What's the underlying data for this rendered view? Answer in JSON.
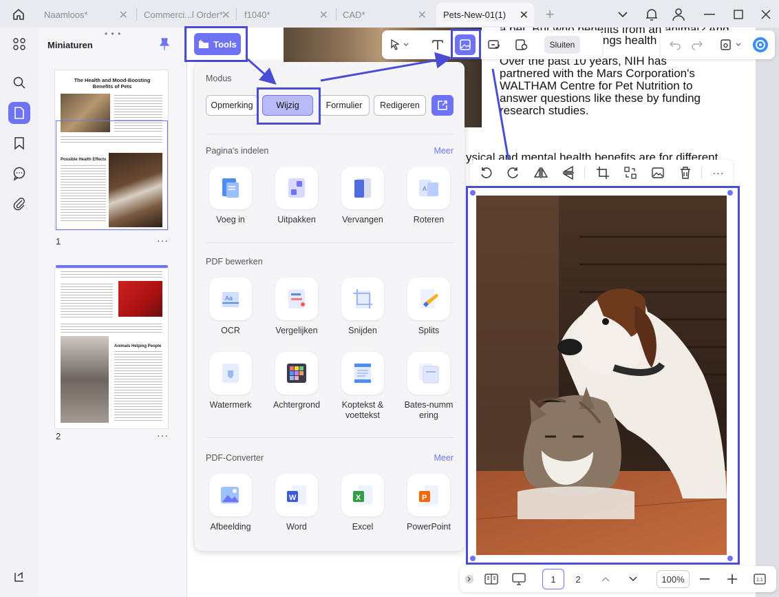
{
  "tabs": [
    {
      "label": "Naamloos*"
    },
    {
      "label": "Commerci...l Order*"
    },
    {
      "label": "f1040*"
    },
    {
      "label": "CAD*"
    },
    {
      "label": "Pets-New-01(1)"
    }
  ],
  "thumbnails": {
    "title": "Miniaturen",
    "pages": [
      {
        "num": "1",
        "heading": "The Health and Mood-Boosting Benefits of Pets",
        "subheading": "Possible Health Effects"
      },
      {
        "num": "2",
        "subheading": "Animals Helping People"
      }
    ]
  },
  "toolbar": {
    "tools_label": "Tools",
    "sluiten_label": "Sluiten"
  },
  "panel": {
    "modus_title": "Modus",
    "modes": [
      "Opmerking",
      "Wijzig",
      "Formulier",
      "Redigeren"
    ],
    "active_mode": "Wijzig",
    "section1": {
      "title": "Pagina's indelen",
      "more": "Meer",
      "items": [
        "Voeg in",
        "Uitpakken",
        "Vervangen",
        "Roteren"
      ]
    },
    "section2": {
      "title": "PDF bewerken",
      "items": [
        "OCR",
        "Vergelijken",
        "Snijden",
        "Splits",
        "Watermerk",
        "Achtergrond",
        "Koptekst & voettekst",
        "Bates-numm ering"
      ]
    },
    "section3": {
      "title": "PDF-Converter",
      "more": "Meer",
      "items": [
        "Afbeelding",
        "Word",
        "Excel",
        "PowerPoint"
      ]
    }
  },
  "document": {
    "line0": "a pet. But who benefits from an animal? And",
    "line1": "brings health be",
    "para": [
      "Over  the  past  10  years,  NIH  has",
      "partnered with the Mars Corporation's",
      "WALTHAM Centre for  Pet  Nutrition  to",
      "answer  questions  like these by funding",
      "research studies."
    ],
    "line_partial": "ysical and mental health benefits are for different"
  },
  "bottombar": {
    "page1": "1",
    "page2": "2",
    "zoom": "100%"
  },
  "colors": {
    "accent": "#6e73f5",
    "highlight": "#4a4dd4"
  }
}
